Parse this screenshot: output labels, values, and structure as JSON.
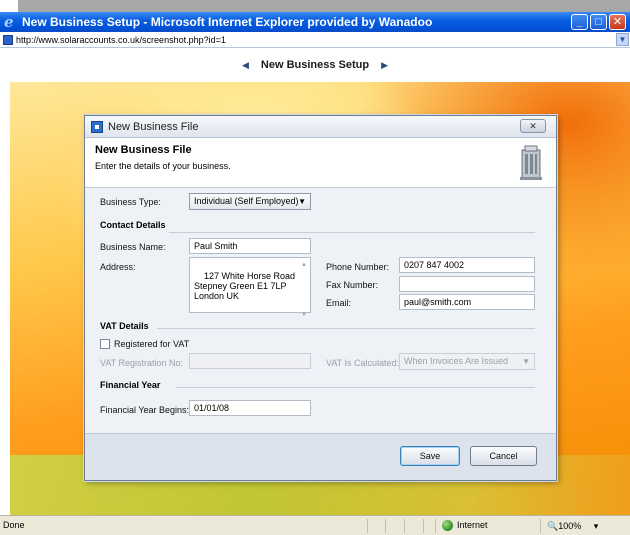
{
  "browser": {
    "title": "New Business Setup - Microsoft Internet Explorer provided by Wanadoo",
    "url": "http://www.solaraccounts.co.uk/screenshot.php?id=1",
    "status": "Done",
    "zone": "Internet",
    "zoom": "100%"
  },
  "page": {
    "nav_title": "New Business Setup"
  },
  "dialog": {
    "window_title": "New Business File",
    "heading": "New Business File",
    "subheading": "Enter the details of your business.",
    "business_type_label": "Business Type:",
    "business_type_value": "Individual (Self Employed)",
    "contact_section": "Contact Details",
    "business_name_label": "Business Name:",
    "business_name_value": "Paul Smith",
    "address_label": "Address:",
    "address_value": "127 White Horse Road\nStepney Green E1 7LP\nLondon UK",
    "phone_label": "Phone Number:",
    "phone_value": "0207 847 4002",
    "fax_label": "Fax Number:",
    "fax_value": "",
    "email_label": "Email:",
    "email_value": "paul@smith.com",
    "vat_section": "VAT Details",
    "registered_vat_label": "Registered for VAT",
    "registered_vat_checked": false,
    "vat_reg_label": "VAT Registration No:",
    "vat_reg_value": "",
    "vat_calc_label": "VAT Is Calculated:",
    "vat_calc_value": "When Invoices Are Issued",
    "financial_section": "Financial Year",
    "fy_begins_label": "Financial Year Begins:",
    "fy_begins_value": "01/01/08",
    "save_label": "Save",
    "cancel_label": "Cancel"
  }
}
